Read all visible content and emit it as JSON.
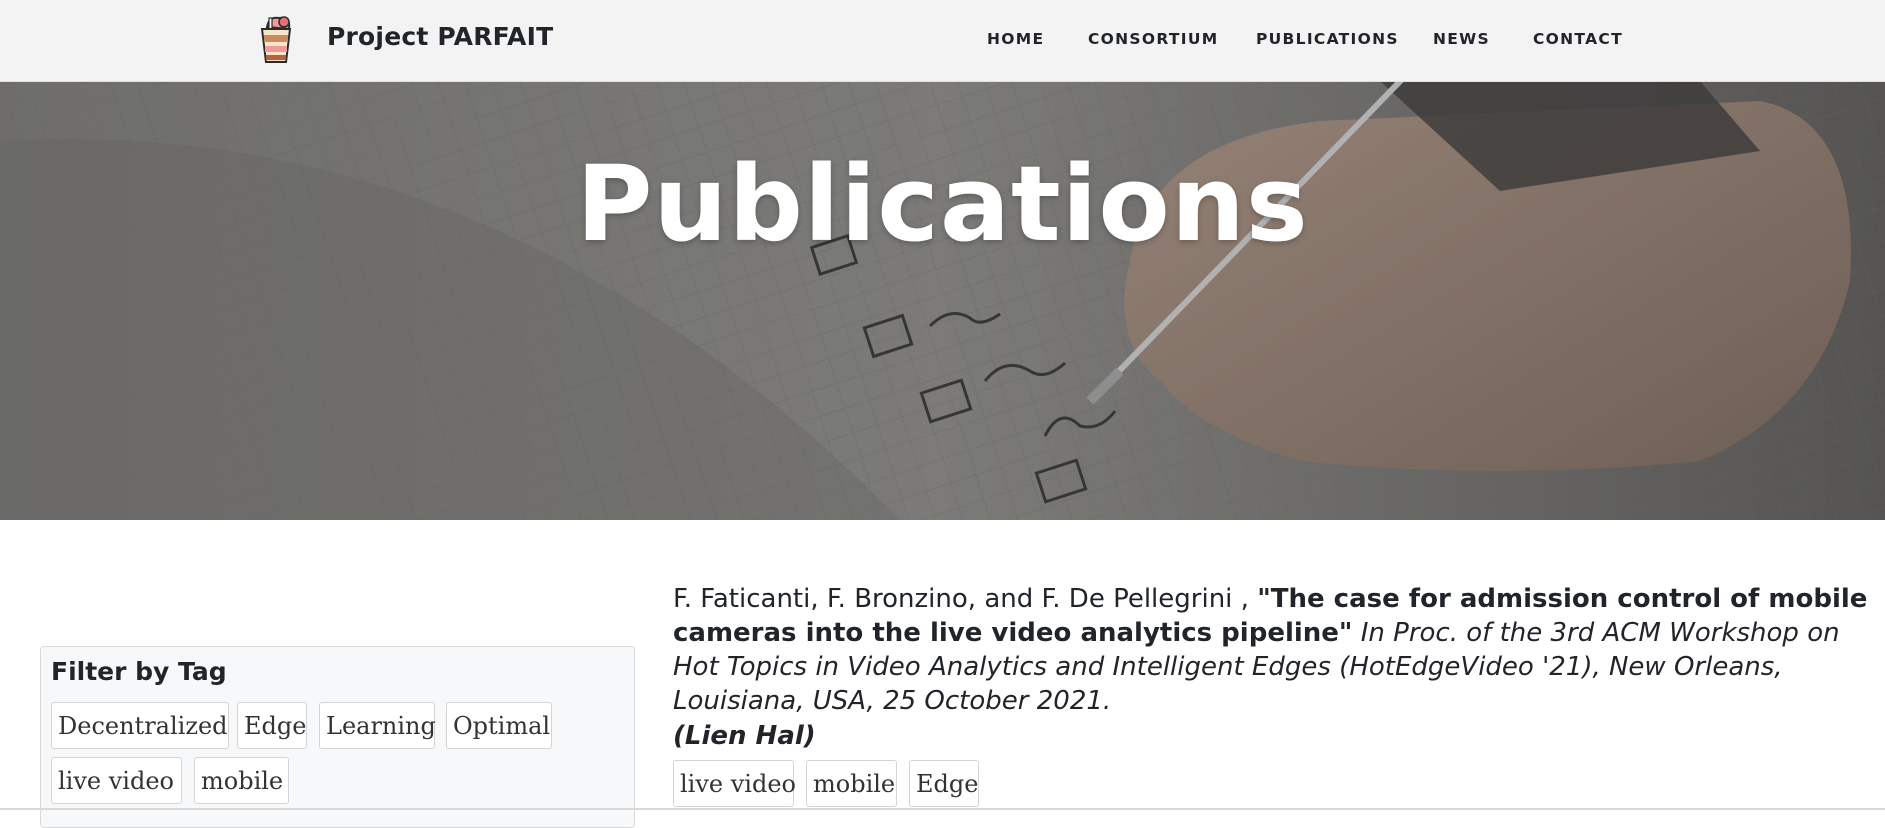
{
  "navbar": {
    "brand": "Project PARFAIT",
    "links": [
      "HOME",
      "CONSORTIUM",
      "PUBLICATIONS",
      "NEWS",
      "CONTACT"
    ]
  },
  "hero": {
    "title": "Publications"
  },
  "sidebar": {
    "filter_title": "Filter by Tag",
    "tags": [
      "Decentralized",
      "Edge",
      "Learning",
      "Optimal",
      "live video",
      "mobile"
    ]
  },
  "publication": {
    "authors": "F. Faticanti, F. Bronzino, and F. De Pellegrini ,",
    "title": "\"The case for admission control of mobile cameras into the live video analytics pipeline\"",
    "venue": "In Proc. of the 3rd ACM Workshop on Hot Topics in Video Analytics and Intelligent Edges (HotEdgeVideo '21), New Orleans, Louisiana, USA, 25 October 2021.",
    "hal": "(Lien Hal)",
    "tags": [
      "live video",
      "mobile",
      "Edge"
    ]
  },
  "colors": {
    "nav_bg": "#f3f3f3",
    "hero_overlay": "#5e5e5e",
    "text": "#212529"
  },
  "icons": {
    "logo": "parfait-cup-icon"
  }
}
